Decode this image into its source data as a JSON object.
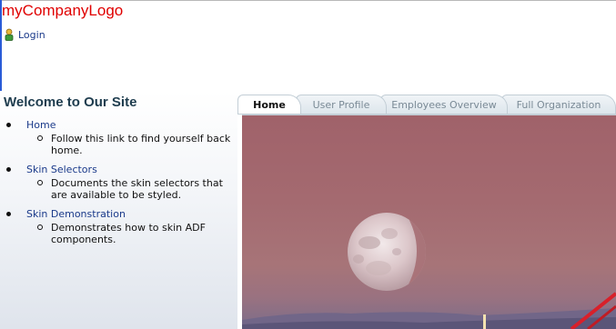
{
  "header": {
    "logo_text": "myCompanyLogo",
    "login_label": "Login",
    "login_icon": "user-login-icon"
  },
  "sidebar": {
    "title": "Welcome to Our Site",
    "items": [
      {
        "label": "Home",
        "description": "Follow this link to find yourself back home."
      },
      {
        "label": "Skin Selectors",
        "description": "Documents the skin selectors that are available to be styled."
      },
      {
        "label": "Skin Demonstration",
        "description": "Demonstrates how to skin ADF components."
      }
    ]
  },
  "tabs": [
    {
      "label": "Home",
      "active": true
    },
    {
      "label": "User Profile",
      "active": false
    },
    {
      "label": "Employees Overview",
      "active": false
    },
    {
      "label": "Full Organization",
      "active": false
    }
  ],
  "colors": {
    "logo": "#e00000",
    "link": "#1a3a8a",
    "title": "#1e3c4e",
    "sky": "#a0626a"
  }
}
